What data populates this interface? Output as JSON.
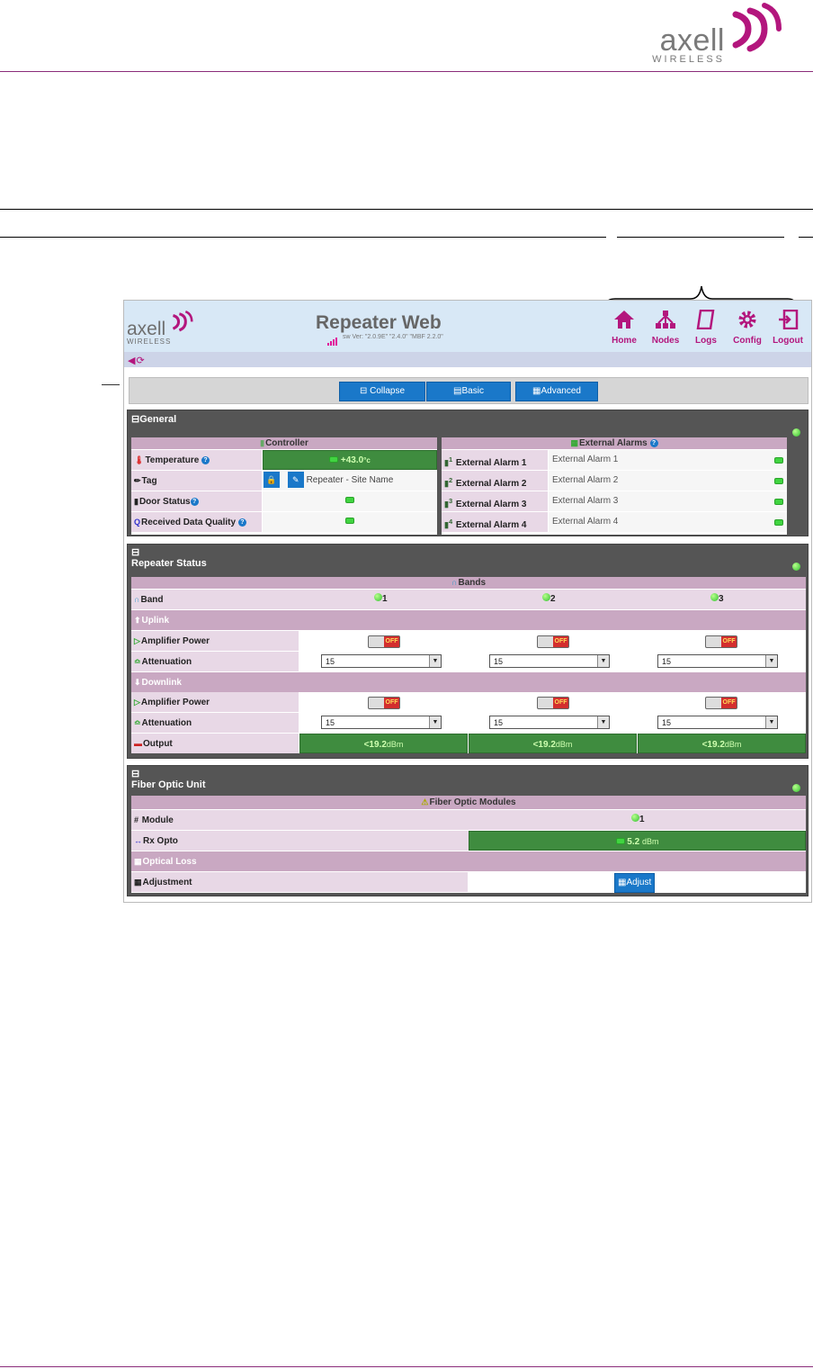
{
  "brand": {
    "name": "axell",
    "sub": "WIRELESS"
  },
  "app": {
    "title": "Repeater Web",
    "version": "sw Ver: \"2.0.9E\" \"2.4.0\" \"MBF 2.2.0\"",
    "logo_name": "axell",
    "logo_sub": "WIRELESS"
  },
  "nav": [
    {
      "label": "Home",
      "icon": "home-icon"
    },
    {
      "label": "Nodes",
      "icon": "nodes-icon"
    },
    {
      "label": "Logs",
      "icon": "logs-icon"
    },
    {
      "label": "Config",
      "icon": "gear-icon"
    },
    {
      "label": "Logout",
      "icon": "logout-icon"
    }
  ],
  "toolbar": {
    "collapse": "Collapse",
    "basic": "Basic",
    "advanced": "Advanced"
  },
  "general": {
    "title": "General",
    "controller_header": "Controller",
    "alarms_header": "External Alarms",
    "temperature_label": "Temperature",
    "temperature_value": "+43.0",
    "temperature_unit": "°c",
    "tag_label": "Tag",
    "tag_value": "Repeater - Site Name",
    "door_label": "Door Status",
    "rdq_label": "Received Data Quality",
    "alarms": [
      {
        "label": "External Alarm 1",
        "value": "External Alarm 1",
        "num": "1"
      },
      {
        "label": "External Alarm 2",
        "value": "External Alarm 2",
        "num": "2"
      },
      {
        "label": "External Alarm 3",
        "value": "External Alarm 3",
        "num": "3"
      },
      {
        "label": "External Alarm 4",
        "value": "External Alarm 4",
        "num": "4"
      }
    ]
  },
  "repeater": {
    "title": "Repeater Status",
    "bands_header": "Bands",
    "band_label": "Band",
    "bands": [
      "1",
      "2",
      "3"
    ],
    "uplink_label": "Uplink",
    "downlink_label": "Downlink",
    "amp_label": "Amplifier Power",
    "att_label": "Attenuation",
    "output_label": "Output",
    "toggle_text": "OFF",
    "att_value": "15",
    "output_value": "<19.2",
    "output_unit": "dBm"
  },
  "fiber": {
    "title": "Fiber Optic Unit",
    "modules_header": "Fiber Optic Modules",
    "module_label": "Module",
    "module_value": "1",
    "rx_label": "Rx Opto",
    "rx_value": "5.2",
    "rx_unit": "dBm",
    "loss_label": "Optical Loss",
    "adjust_label": "Adjustment",
    "adjust_button": "Adjust"
  },
  "colors": {
    "brand": "#b3167d",
    "accent_blue": "#1a78c9",
    "status_green": "#3f8c3f"
  }
}
